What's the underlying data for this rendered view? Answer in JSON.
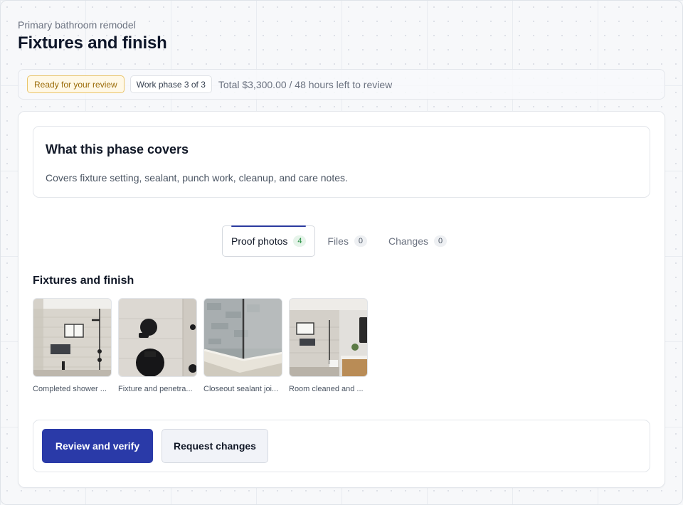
{
  "header": {
    "project_name": "Primary bathroom remodel",
    "title": "Fixtures and finish"
  },
  "meta": {
    "status_badge": "Ready for your review",
    "phase_badge": "Work phase 3 of 3",
    "total_text": "Total $3,300.00 / 48 hours left to review"
  },
  "covers": {
    "title": "What this phase covers",
    "text": "Covers fixture setting, sealant, punch work, cleanup, and care notes."
  },
  "tabs": [
    {
      "label": "Proof photos",
      "count": "4",
      "active": true
    },
    {
      "label": "Files",
      "count": "0",
      "active": false
    },
    {
      "label": "Changes",
      "count": "0",
      "active": false
    }
  ],
  "gallery": {
    "title": "Fixtures and finish",
    "photos": [
      {
        "caption": "Completed shower ...",
        "icon": "shower-photo"
      },
      {
        "caption": "Fixture and penetra...",
        "icon": "fixture-photo"
      },
      {
        "caption": "Closeout sealant joi...",
        "icon": "sealant-photo"
      },
      {
        "caption": "Room cleaned and ...",
        "icon": "room-photo"
      }
    ]
  },
  "actions": {
    "primary": "Review and verify",
    "secondary": "Request changes"
  },
  "colors": {
    "primary": "#2a3aa8",
    "review_badge_bg": "#fff8e6",
    "review_badge_border": "#e9c46a",
    "active_tab_accent": "#2a3a9e",
    "photo_count_green": "#1f8a3b"
  }
}
